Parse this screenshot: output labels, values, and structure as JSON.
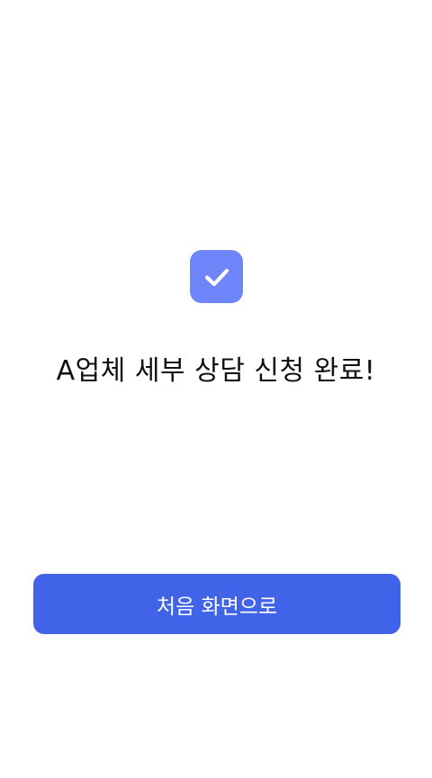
{
  "icon": {
    "name": "check-icon",
    "badge_color": "#6f86fb"
  },
  "message": {
    "text": "A업체 세부 상담 신청 완료!"
  },
  "home_button": {
    "label": "처음 화면으로",
    "color": "#4163e8"
  }
}
